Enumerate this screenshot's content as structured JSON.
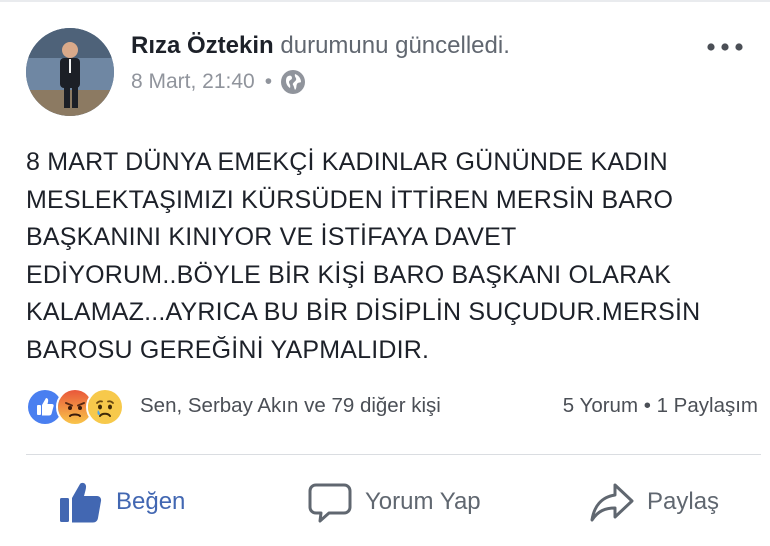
{
  "post": {
    "author_name": "Rıza Öztekin",
    "action_text": "durumunu güncelledi.",
    "date": "8 Mart, 21:40",
    "separator": "•",
    "privacy_icon": "globe-icon",
    "text": "8 MART DÜNYA EMEKÇİ KADINLAR GÜNÜNDE  KADIN\nMESLEKTAŞIMIZI KÜRSÜDEN İTTİREN  MERSİN BARO\nBAŞKANINI KINIYOR VE İSTİFAYA DAVET\nEDİYORUM..BÖYLE BİR KİŞİ BARO BAŞKANI OLARAK\nKALAMAZ...AYRICA  BU BİR DİSİPLİN SUÇUDUR.MERSİN\nBAROSU GEREĞİNİ YAPMALIDIR."
  },
  "reactions": {
    "icons": [
      "like-reaction-icon",
      "angry-reaction-icon",
      "sad-reaction-icon"
    ],
    "summary": "Sen, Serbay Akın ve 79 diğer kişi",
    "counts": "5 Yorum • 1 Paylaşım"
  },
  "actions": {
    "like": "Beğen",
    "comment": "Yorum Yap",
    "share": "Paylaş"
  },
  "colors": {
    "brand_blue": "#4267b2",
    "text_primary": "#1d2129",
    "text_secondary": "#90949c",
    "reaction_angry": "#f0672b",
    "reaction_sad": "#f7c94b"
  }
}
